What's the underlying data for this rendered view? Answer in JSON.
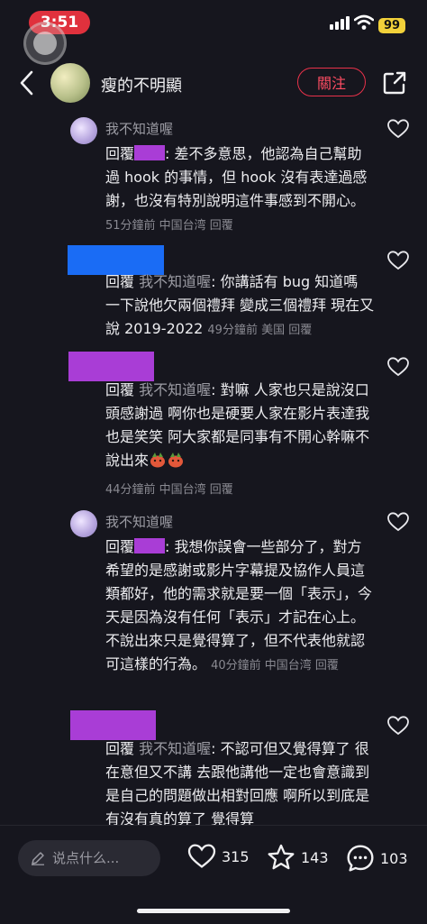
{
  "status_bar": {
    "time": "3:51",
    "battery": "99"
  },
  "header": {
    "title": "瘦的不明顯",
    "follow_label": "關注"
  },
  "comments": [
    {
      "username": "我不知道喔",
      "reply_prefix": "回覆",
      "body": ": 差不多意思，他認為自己幫助過 hook 的事情，但 hook 沒有表達過感謝，也沒有特別說明這件事感到不開心。",
      "meta": "51分鐘前 中国台湾 回覆"
    },
    {
      "reply_prefix": "回覆",
      "reply_to": "我不知道喔",
      "body": ": 你講話有 bug 知道嗎 一下說他欠兩個禮拜 變成三個禮拜 現在又說 2019-2022",
      "meta": "49分鐘前 美国 回覆"
    },
    {
      "reply_prefix": "回覆",
      "reply_to": "我不知道喔",
      "body": ": 對嘛 人家也只是說沒口頭感謝過 啊你也是硬要人家在影片表達我也是笑笑 阿大家都是同事有不開心幹嘛不說出來",
      "meta": "44分鐘前 中国台湾 回覆"
    },
    {
      "username": "我不知道喔",
      "reply_prefix": "回覆",
      "body": ": 我想你誤會一些部分了，對方希望的是感謝或影片字幕提及協作人員這類都好，他的需求就是要一個「表示」，今天是因為沒有任何「表示」才記在心上。不說出來只是覺得算了，但不代表他就認可這樣的行為。",
      "meta": "40分鐘前 中国台湾 回覆"
    },
    {
      "reply_prefix": "回覆",
      "reply_to": "我不知道喔",
      "body": ": 不認可但又覺得算了 很在意但又不講 去跟他講他一定也會意識到是自己的問題做出相對回應 啊所以到底是有沒有真的算了 覺得算"
    }
  ],
  "bottom_bar": {
    "input_placeholder": "说点什么...",
    "likes": "315",
    "favorites": "143",
    "comments": "103"
  },
  "colors": {
    "accent_red": "#e8324a",
    "redact_purple": "#a93dd6",
    "redact_blue": "#1a6cf5",
    "background": "#16161e"
  }
}
